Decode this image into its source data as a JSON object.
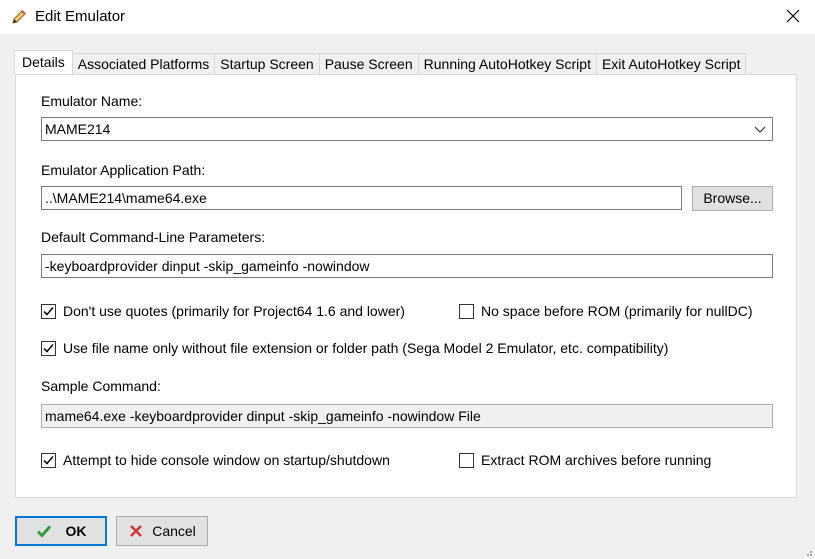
{
  "window": {
    "title": "Edit Emulator",
    "icon": "pencil-icon"
  },
  "tabs": [
    {
      "label": "Details",
      "active": true
    },
    {
      "label": "Associated Platforms",
      "active": false
    },
    {
      "label": "Startup Screen",
      "active": false
    },
    {
      "label": "Pause Screen",
      "active": false
    },
    {
      "label": "Running AutoHotkey Script",
      "active": false
    },
    {
      "label": "Exit AutoHotkey Script",
      "active": false
    }
  ],
  "details": {
    "emulator_name_label": "Emulator Name:",
    "emulator_name_value": "MAME214",
    "app_path_label": "Emulator Application Path:",
    "app_path_value": "..\\MAME214\\mame64.exe",
    "browse_label": "Browse...",
    "cmdline_label": "Default Command-Line Parameters:",
    "cmdline_value": "-keyboardprovider dinput -skip_gameinfo -nowindow",
    "no_quotes_label": "Don't use quotes (primarily for Project64 1.6 and lower)",
    "no_quotes_checked": true,
    "no_space_label": "No space before ROM (primarily for nullDC)",
    "no_space_checked": false,
    "filename_only_label": "Use file name only without file extension or folder path (Sega Model 2 Emulator, etc. compatibility)",
    "filename_only_checked": true,
    "sample_label": "Sample Command:",
    "sample_value": "mame64.exe -keyboardprovider dinput -skip_gameinfo -nowindow File",
    "hide_console_label": "Attempt to hide console window on startup/shutdown",
    "hide_console_checked": true,
    "extract_rom_label": "Extract ROM archives before running",
    "extract_rom_checked": false
  },
  "footer": {
    "ok_label": "OK",
    "cancel_label": "Cancel"
  },
  "colors": {
    "accent": "#0078d7",
    "ok_check": "#2e9e3e",
    "cancel_x": "#d13438"
  }
}
